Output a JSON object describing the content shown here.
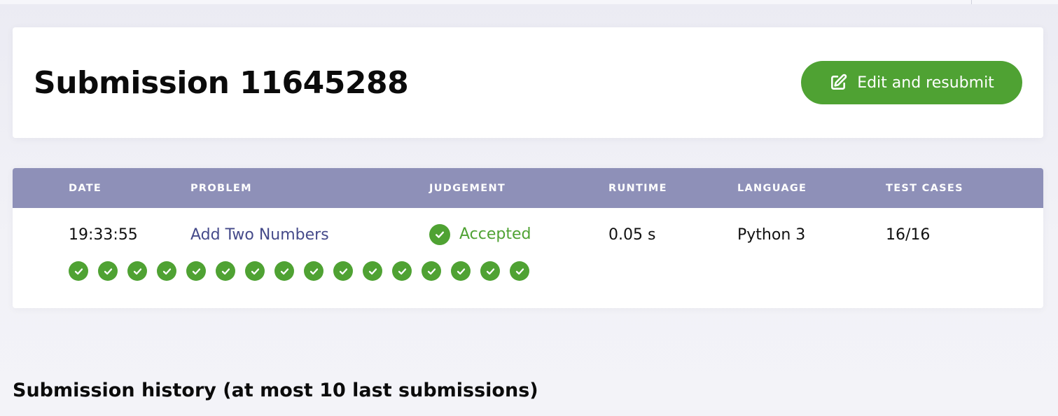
{
  "page": {
    "title": "Submission 11645288",
    "resubmit_label": "Edit and resubmit",
    "resubmit_icon": "edit-icon"
  },
  "table": {
    "headers": [
      "DATE",
      "PROBLEM",
      "JUDGEMENT",
      "RUNTIME",
      "LANGUAGE",
      "TEST CASES"
    ],
    "row": {
      "date": "19:33:55",
      "problem": "Add Two Numbers",
      "judgement": "Accepted",
      "runtime": "0.05 s",
      "language": "Python 3",
      "test_cases": "16/16"
    },
    "test_case_results": [
      "passed",
      "passed",
      "passed",
      "passed",
      "passed",
      "passed",
      "passed",
      "passed",
      "passed",
      "passed",
      "passed",
      "passed",
      "passed",
      "passed",
      "passed",
      "passed"
    ]
  },
  "history": {
    "heading": "Submission history (at most 10 last submissions)"
  },
  "colors": {
    "accent_green": "#4fa233",
    "table_header": "#8e90b8",
    "link": "#454a8a"
  }
}
